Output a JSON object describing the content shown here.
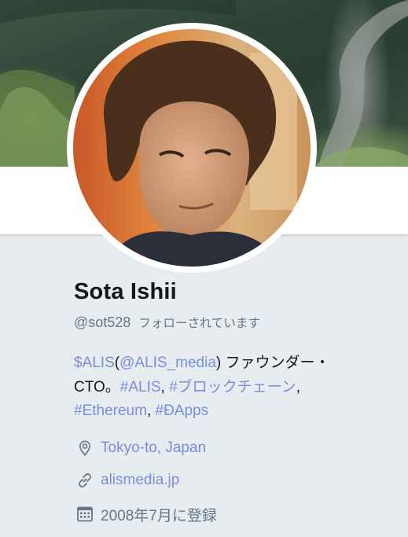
{
  "profile": {
    "name": "Sota Ishii",
    "handle": "@sot528",
    "follows_you": "フォローされています"
  },
  "bio": {
    "cashtag_alis": "$ALIS",
    "paren_open": "(",
    "mention_alis_media": "@ALIS_media",
    "paren_close_founder": ") ファウンダー・",
    "cto": "CTO。",
    "hashtag_alis": "#ALIS",
    "comma1": ", ",
    "hashtag_blockchain": "#ブロックチェーン",
    "comma2": ",",
    "hashtag_ethereum": "#Ethereum",
    "comma3": ", ",
    "hashtag_dapps": "#ÐApps"
  },
  "meta": {
    "location": "Tokyo-to, Japan",
    "location_icon": "map-pin-icon",
    "website": "alismedia.jp",
    "website_icon": "link-icon",
    "joined": "2008年7月に登録",
    "joined_icon": "calendar-icon"
  },
  "colors": {
    "link": "#7a8dd8",
    "secondary_text": "#657786",
    "primary_text": "#14171a",
    "background": "#e6ecf0"
  }
}
